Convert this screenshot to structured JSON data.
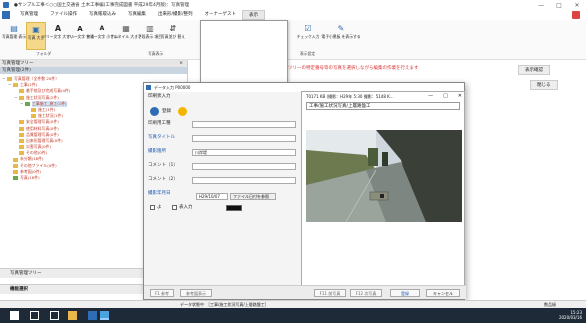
{
  "window": {
    "title": "●サンプル工事＜○○国土交通省 土木工事編(工事完成図書 平成29年4月版)：写真管理",
    "minimize": "—",
    "maximize": "□",
    "close": "✕"
  },
  "menu": [
    "写真管理",
    "ファイル操作",
    "写真帳取込み",
    "写真編集",
    "出来形/撮影/整列",
    "オーナーゲスト",
    "表示"
  ],
  "ribbon": {
    "buttons": [
      {
        "icon": "folder-add-icon",
        "glyph": "▤",
        "label": "写真管理 表示"
      },
      {
        "icon": "photo-large-icon",
        "glyph": "▣",
        "label": "写真 大き"
      },
      {
        "icon": "text-a-icon",
        "glyph": "A",
        "label": "ツリー文字 大きい"
      },
      {
        "icon": "text-a-icon",
        "glyph": "A",
        "label": "ツリー文字 普通"
      },
      {
        "icon": "text-a-icon",
        "glyph": "A",
        "label": "ツリー文字 小さい"
      },
      {
        "icon": "thumbnail-icon",
        "glyph": "▦",
        "label": "サムネイル 大きさ"
      },
      {
        "icon": "lower-pane-icon",
        "glyph": "▥",
        "label": "下段表示 項目"
      },
      {
        "icon": "sort-icon",
        "glyph": "⇵",
        "label": "写真並び 替え"
      }
    ],
    "groups": [
      "フォルダ",
      "写真表示"
    ],
    "right_buttons": [
      {
        "icon": "check-icon",
        "glyph": "☑",
        "label": "チェック入力"
      },
      {
        "icon": "edit-item-icon",
        "glyph": "✎",
        "label": "電子小黒板 を表示する"
      }
    ],
    "right_group": "表示設定"
  },
  "left_panel": {
    "header": "写真管理ツリー",
    "close": "×",
    "sub": "写真管理(2件)",
    "tree": [
      {
        "level": 0,
        "exp": "−",
        "folder": "y",
        "text": "写真管理（全件数 20件）",
        "sel": false
      },
      {
        "level": 1,
        "exp": "−",
        "folder": "y",
        "text": "工事(2件)",
        "sel": false
      },
      {
        "level": 2,
        "exp": "",
        "folder": "y",
        "text": "着手前及び完成写真(0件)",
        "sel": false
      },
      {
        "level": 2,
        "exp": "−",
        "folder": "y",
        "text": "施工状況写真(2件)",
        "sel": false
      },
      {
        "level": 3,
        "exp": "−",
        "folder": "g",
        "text": "工事施工_施工(1件)",
        "sel": true
      },
      {
        "level": 4,
        "exp": "",
        "folder": "y",
        "text": "施工(1件)",
        "sel": false
      },
      {
        "level": 4,
        "exp": "",
        "folder": "y",
        "text": "施工状況(1件)",
        "sel": false
      },
      {
        "level": 2,
        "exp": "",
        "folder": "y",
        "text": "安全管理写真(0件)",
        "sel": false
      },
      {
        "level": 2,
        "exp": "",
        "folder": "y",
        "text": "使用材料写真(0件)",
        "sel": false
      },
      {
        "level": 2,
        "exp": "",
        "folder": "y",
        "text": "品質管理写真(0件)",
        "sel": false
      },
      {
        "level": 2,
        "exp": "",
        "folder": "y",
        "text": "出来形管理写真(0件)",
        "sel": false
      },
      {
        "level": 2,
        "exp": "",
        "folder": "y",
        "text": "災害写真(0件)",
        "sel": false
      },
      {
        "level": 2,
        "exp": "",
        "folder": "y",
        "text": "その他(0件)",
        "sel": false
      },
      {
        "level": 1,
        "exp": "",
        "folder": "y",
        "text": "未分類(18件)",
        "sel": false
      },
      {
        "level": 1,
        "exp": "",
        "folder": "y",
        "text": "その他ファイル(0件)",
        "sel": false
      },
      {
        "level": 1,
        "exp": "",
        "folder": "y",
        "text": "参考図(0件)",
        "sel": false
      },
      {
        "level": 1,
        "exp": "",
        "folder": "g",
        "text": "写真(18件)",
        "sel": false
      }
    ],
    "footer1": "写真管理ツリー",
    "footer2": "機能選択"
  },
  "right_area": {
    "notice": "ツリーの特定番号等の写真を選択しながら編集の作業を行えます",
    "btn1": "表示確認",
    "btn2": "閉じる"
  },
  "dialog": {
    "title": "データ入力 P00000",
    "close": "×",
    "tab": "印刷状入力",
    "reg_label": "登録",
    "fields": [
      {
        "label": "印刷用工種",
        "blue": false,
        "value": ""
      },
      {
        "label": "写真タイトル",
        "blue": true,
        "value": ""
      },
      {
        "label": "撮影箇所",
        "blue": true,
        "value": "川岸堤"
      },
      {
        "label": "コメント（1）",
        "blue": false,
        "value": ""
      },
      {
        "label": "コメント（2）",
        "blue": false,
        "value": ""
      },
      {
        "label": "撮影年月日",
        "blue": true,
        "value": "H29/10/07"
      }
    ],
    "file_btn": "ファイル日付を参照",
    "check1": "よ",
    "check2": "表入力",
    "photo_panel": {
      "title": "T0171 KB (撮影：H29年 5:30 撮影：5148 K...",
      "field": "工事/施工状況写真/上層路盤工",
      "min": "—",
      "max": "□",
      "close": "✕"
    },
    "bottom": {
      "f1": "F1 参考",
      "ref": "参考図表示",
      "prev": "F11 前写真",
      "next": "F12 次写真",
      "save": "登録",
      "cancel": "キャンセル"
    }
  },
  "statusbar": {
    "text": "データ状態中　［工事/施工状況写真/上層路盤工］",
    "right": "数品級"
  },
  "taskbar": {
    "time": "15:23",
    "date": "2020/03/16"
  }
}
